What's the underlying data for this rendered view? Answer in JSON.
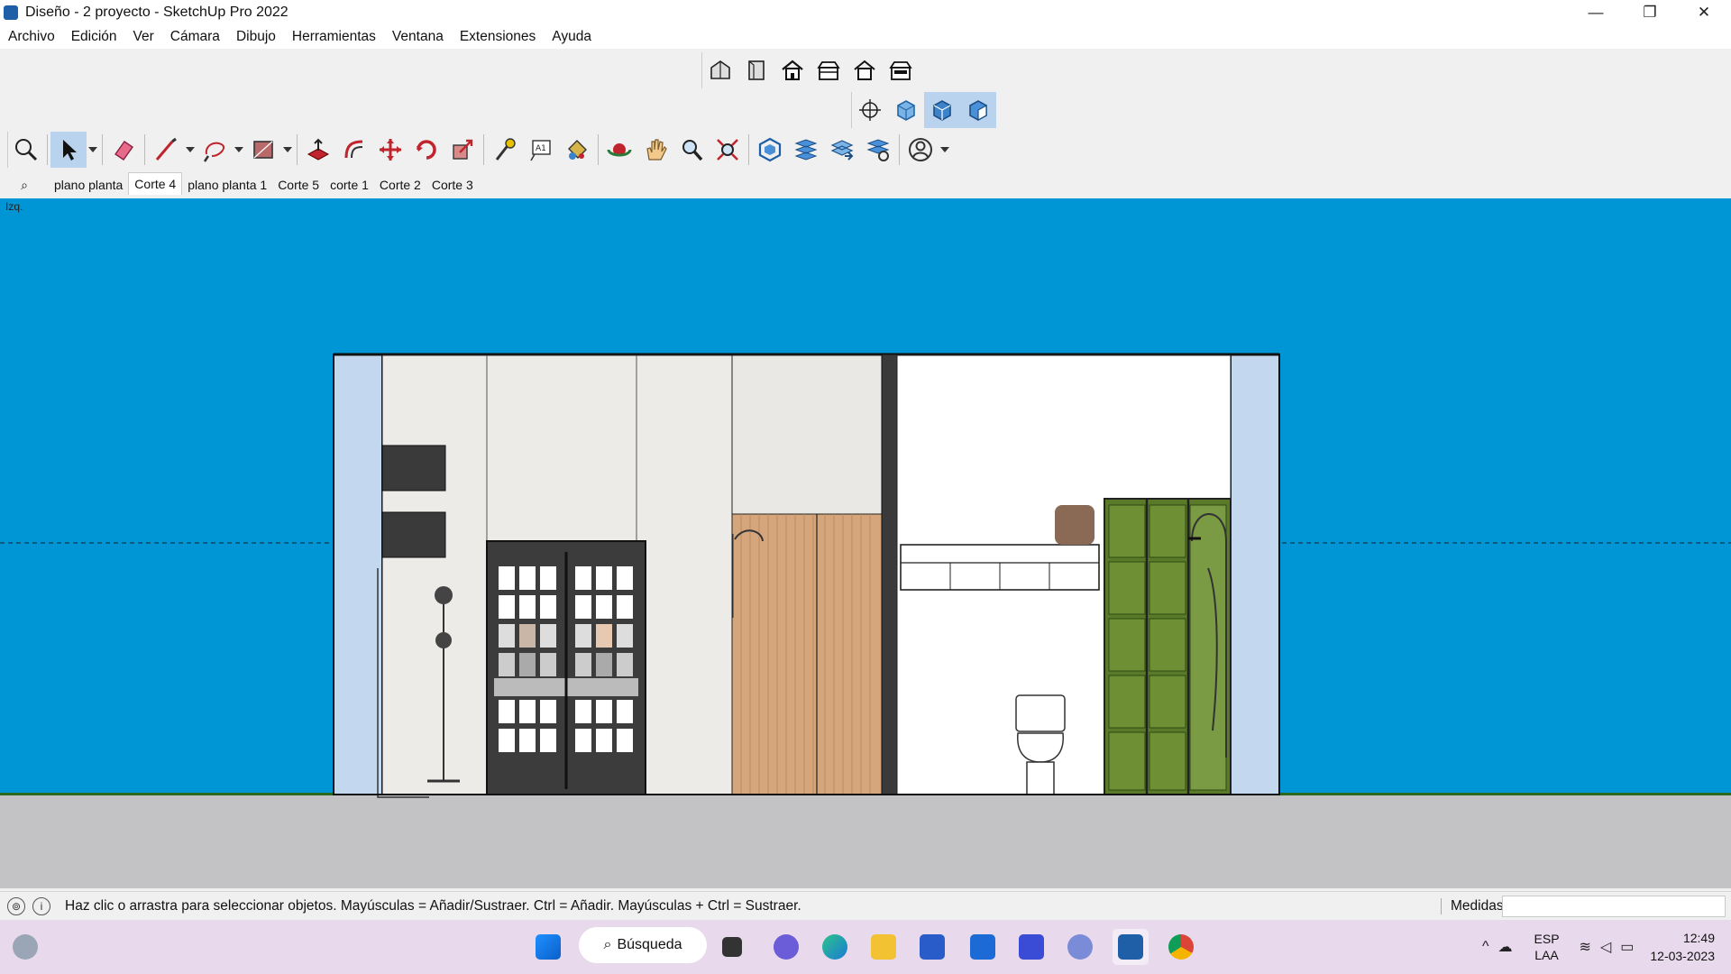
{
  "window": {
    "title": "Diseño - 2 proyecto - SketchUp Pro 2022",
    "controls": [
      "—",
      "❐",
      "✕"
    ]
  },
  "menu": [
    "Archivo",
    "Edición",
    "Ver",
    "Cámara",
    "Dibujo",
    "Herramientas",
    "Ventana",
    "Extensiones",
    "Ayuda"
  ],
  "scenes": {
    "items": [
      "plano planta",
      "Corte 4",
      "plano planta 1",
      "Corte 5",
      "corte 1",
      "Corte 2",
      "Corte 3"
    ],
    "active": "Corte 4"
  },
  "viewport": {
    "view_label": "Izq.",
    "sky_color": "#0096d6",
    "ground_color": "#c3c3c5"
  },
  "status": {
    "message": "Haz clic o arrastra para seleccionar objetos. Mayúsculas = Añadir/Sustraer. Ctrl = Añadir. Mayúsculas + Ctrl = Sustraer.",
    "measurements_label": "Medidas",
    "measurements_value": ""
  },
  "taskbar": {
    "search_label": "Búsqueda",
    "language": "ESP",
    "layout": "LAA",
    "time": "12:49",
    "date": "12-03-2023"
  }
}
